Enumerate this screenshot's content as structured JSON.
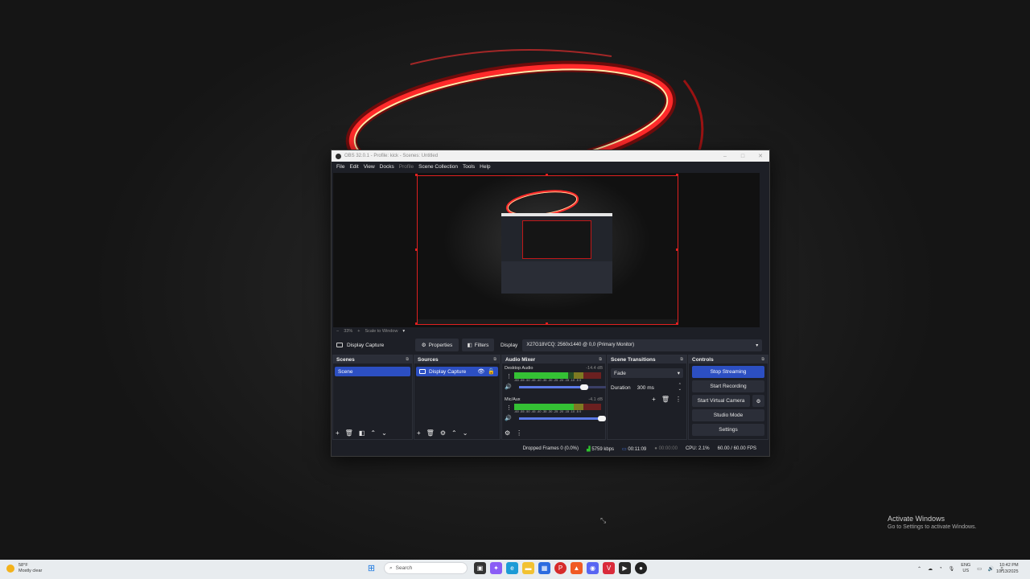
{
  "window": {
    "title": "OBS 32.0.1 - Profile: kick - Scenes: Untitled"
  },
  "menu": [
    "File",
    "Edit",
    "View",
    "Docks",
    "Profile",
    "Scene Collection",
    "Tools",
    "Help"
  ],
  "preview": {
    "zoom": "33%",
    "scale_label": "Scale to Window"
  },
  "source_toolbar": {
    "source_name": "Display Capture",
    "properties": "Properties",
    "filters": "Filters",
    "display_label": "Display",
    "display_value": "X27G18VCQ: 2560x1440 @ 0,0 (Primary Monitor)"
  },
  "scenes": {
    "title": "Scenes",
    "items": [
      "Scene"
    ]
  },
  "sources": {
    "title": "Sources",
    "items": [
      "Display Capture"
    ]
  },
  "mixer": {
    "title": "Audio Mixer",
    "scale_text": "-60 -55 -50 -45 -40 -35 -30 -25 -20 -15 -10 -5 0",
    "channels": [
      {
        "name": "Desktop Audio",
        "db": "-14.4 dB",
        "level": 0.62,
        "volume": 0.75
      },
      {
        "name": "Mic/Aux",
        "db": "-4.1 dB",
        "level": 0.8,
        "volume": 0.97
      }
    ]
  },
  "transitions": {
    "title": "Scene Transitions",
    "selected": "Fade",
    "duration_label": "Duration",
    "duration_value": "300 ms"
  },
  "controls": {
    "title": "Controls",
    "stop_streaming": "Stop Streaming",
    "start_recording": "Start Recording",
    "start_virtual_camera": "Start Virtual Camera",
    "studio_mode": "Studio Mode",
    "settings": "Settings"
  },
  "status": {
    "dropped_frames": "Dropped Frames 0 (0.0%)",
    "bitrate": "5759 kbps",
    "stream_time": "00:11:09",
    "record_time": "00:00:00",
    "cpu": "CPU: 2.1%",
    "fps": "60.00 / 60.00 FPS"
  },
  "desktop": {
    "activate_title": "Activate Windows",
    "activate_sub": "Go to Settings to activate Windows."
  },
  "taskbar": {
    "weather_temp": "58°F",
    "weather_desc": "Mostly clear",
    "search_placeholder": "Search",
    "lang_top": "ENG",
    "lang_bottom": "US",
    "time": "10:42 PM",
    "date": "10/13/2025"
  },
  "colors": {
    "accent": "#2c4fc2",
    "selection_red": "#e02020",
    "meter_green": "#34c134"
  }
}
